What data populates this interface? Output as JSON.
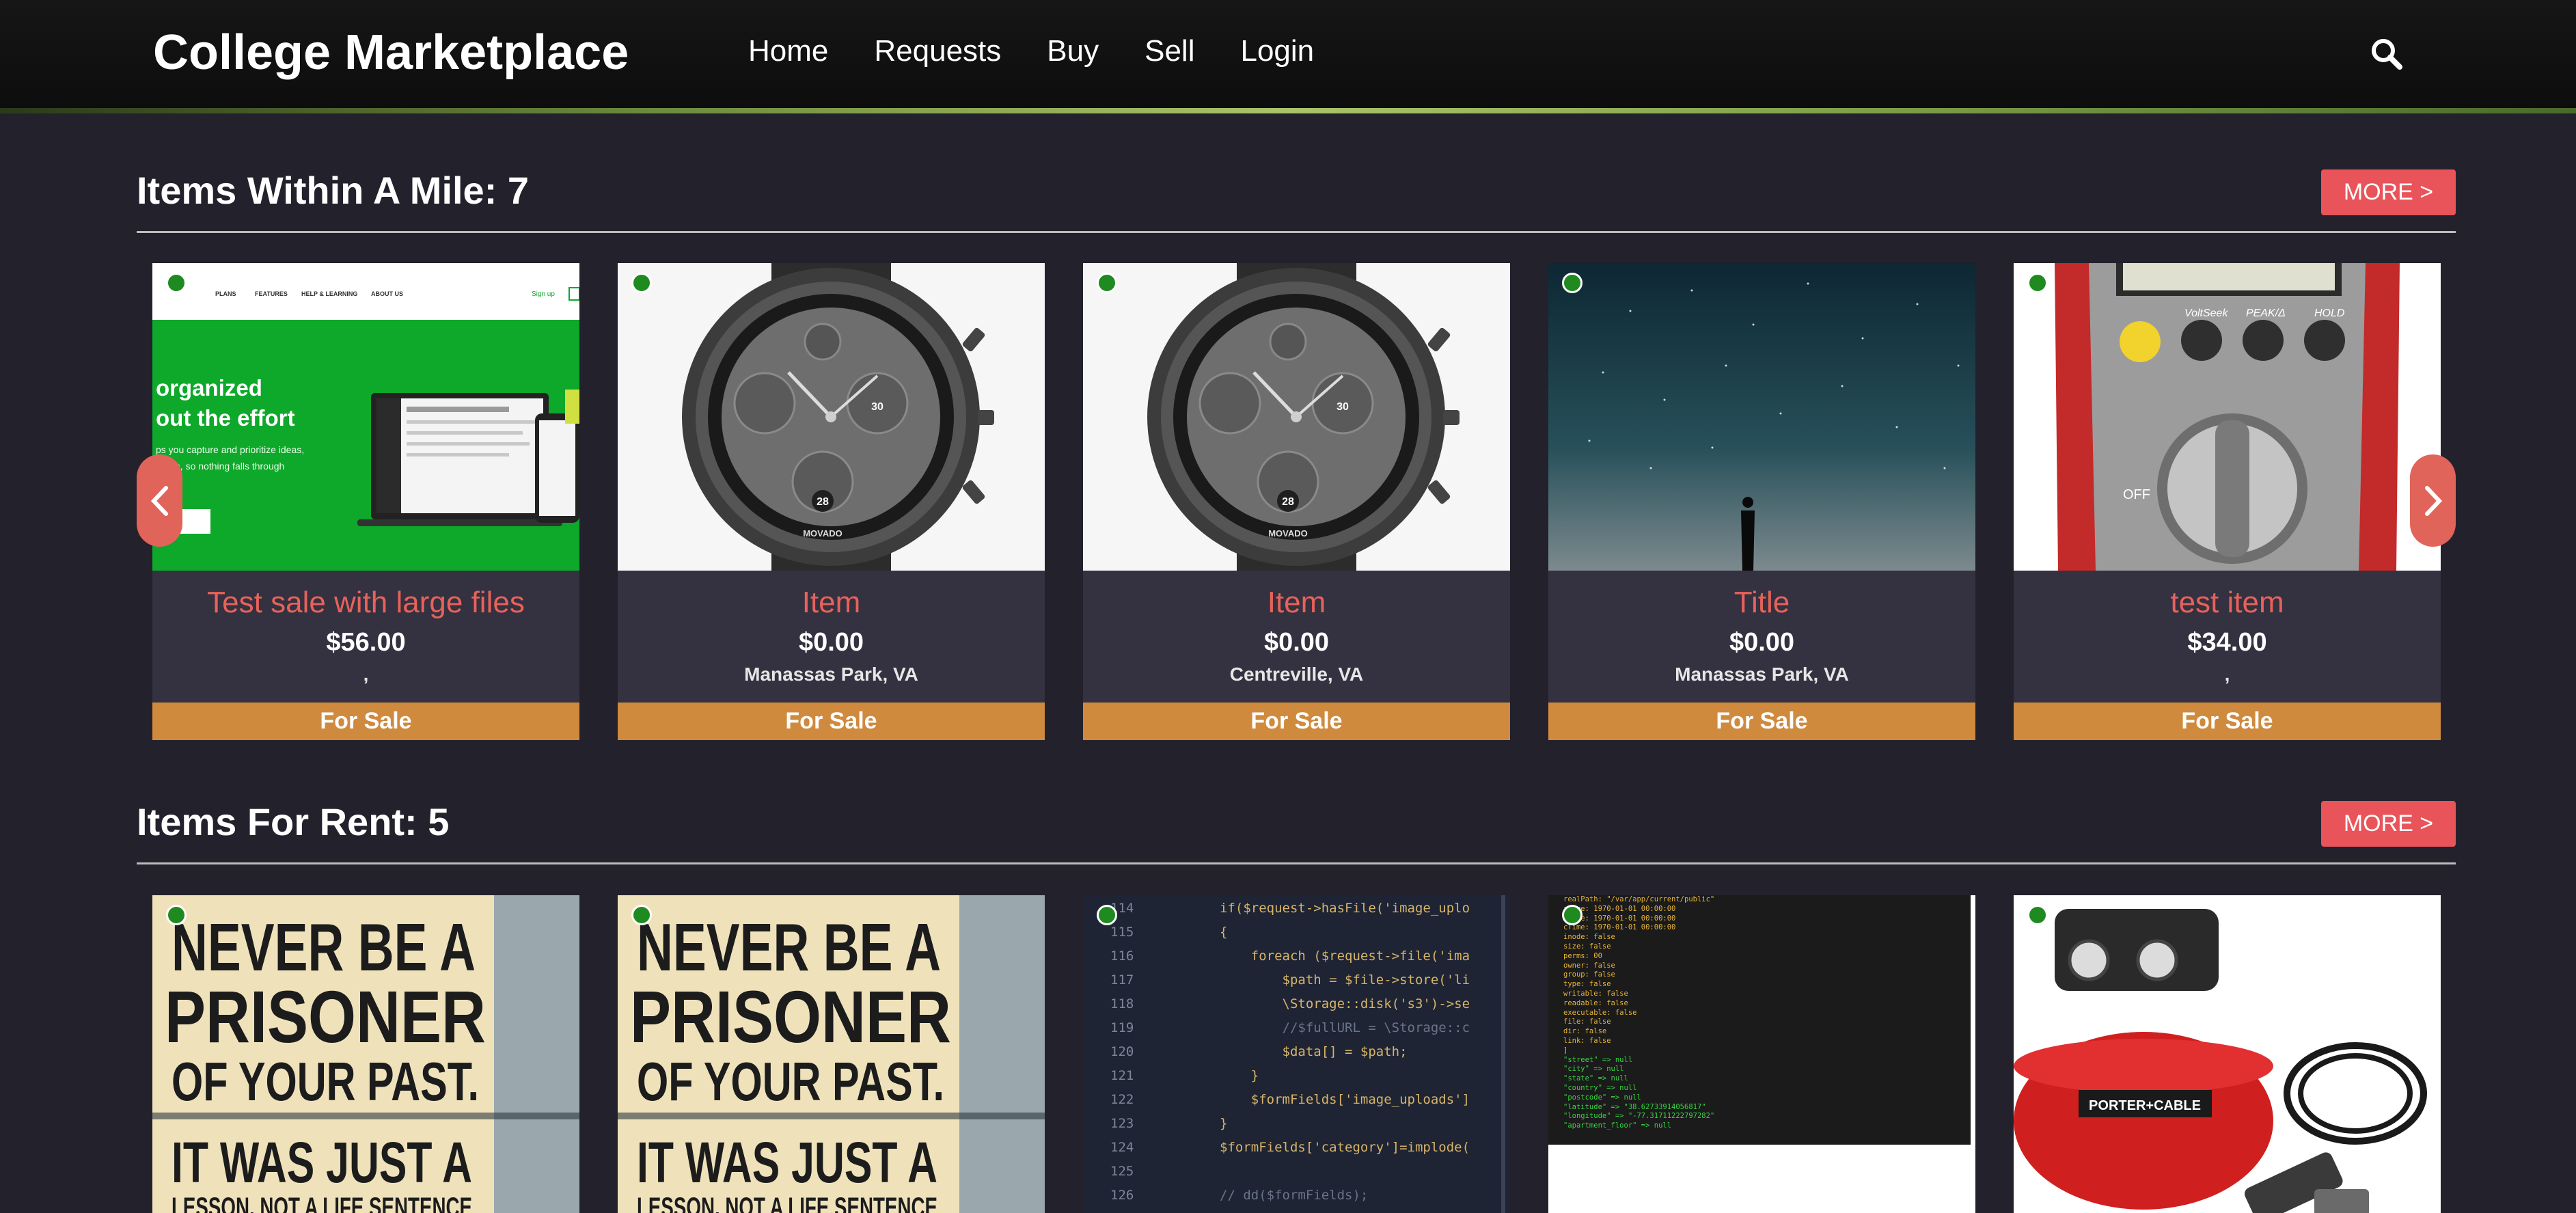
{
  "header": {
    "brand": "College Marketplace",
    "nav": [
      {
        "label": "Home"
      },
      {
        "label": "Requests"
      },
      {
        "label": "Buy"
      },
      {
        "label": "Sell"
      },
      {
        "label": "Login"
      }
    ],
    "search_icon": "search-icon"
  },
  "colors": {
    "accent": "#e8545a",
    "card_title": "#e8625a",
    "status_bar": "#d08a3e",
    "online_dot": "#1f8a1f",
    "background": "#23212c",
    "card_body": "#343140"
  },
  "nearby": {
    "title": "Items Within A Mile: 7",
    "more_label": "MORE >",
    "items": [
      {
        "title": "Test sale with large files",
        "price": "$56.00",
        "location": ",",
        "status": "For Sale",
        "image": "website-screenshot"
      },
      {
        "title": "Item",
        "price": "$0.00",
        "location": "Manassas Park, VA",
        "status": "For Sale",
        "image": "watch"
      },
      {
        "title": "Item",
        "price": "$0.00",
        "location": "Centreville, VA",
        "status": "For Sale",
        "image": "watch"
      },
      {
        "title": "Title",
        "price": "$0.00",
        "location": "Manassas Park, VA",
        "status": "For Sale",
        "image": "night-sky"
      },
      {
        "title": "test item",
        "price": "$34.00",
        "location": ",",
        "status": "For Sale",
        "image": "multimeter"
      }
    ],
    "slide1_text": {
      "menu": [
        "PLANS",
        "FEATURES",
        "HELP & LEARNING",
        "ABOUT US"
      ],
      "signup": "Sign up",
      "headline1": "organized",
      "headline2": "out the effort",
      "sub1": "ps you capture and prioritize ideas,",
      "sub2": "o lists, so nothing falls through"
    },
    "watch_text": {
      "brand": "MOVADO",
      "date": "28",
      "subdial": "30"
    },
    "meter_text": {
      "labels": [
        "VoltSeek",
        "PEAK/Δ",
        "HOLD"
      ],
      "off": "OFF"
    }
  },
  "rent": {
    "title": "Items For Rent: 5",
    "more_label": "MORE >",
    "poster_lines": [
      "NEVER BE A",
      "PRISONER",
      "OF YOUR PAST.",
      "IT WAS JUST A",
      "LESSON, NOT A LIFE SENTENCE"
    ],
    "code_lines": [
      {
        "n": "114",
        "t": "if($request->hasFile('image_uplo"
      },
      {
        "n": "115",
        "t": "{"
      },
      {
        "n": "116",
        "t": "    foreach ($request->file('ima"
      },
      {
        "n": "117",
        "t": "        $path = $file->store('li"
      },
      {
        "n": "118",
        "t": "        \\Storage::disk('s3')->se"
      },
      {
        "n": "119",
        "t": "        //$fullURL = \\Storage::c"
      },
      {
        "n": "120",
        "t": "        $data[] = $path;"
      },
      {
        "n": "121",
        "t": "    }"
      },
      {
        "n": "122",
        "t": "    $formFields['image_uploads']"
      },
      {
        "n": "123",
        "t": "}"
      },
      {
        "n": "124",
        "t": "$formFields['category']=implode("
      },
      {
        "n": "125",
        "t": ""
      },
      {
        "n": "126",
        "t": "// dd($formFields);"
      }
    ],
    "dump_lines": [
      "realPath: \"/var/app/current/public\"",
      "aTime: 1970-01-01 00:00:00",
      "mTime: 1970-01-01 00:00:00",
      "cTime: 1970-01-01 00:00:00",
      "inode: false",
      "size: false",
      "perms: 00",
      "owner: false",
      "group: false",
      "type: false",
      "writable: false",
      "readable: false",
      "executable: false",
      "file: false",
      "dir: false",
      "link: false",
      "]",
      "\"street\" => null",
      "\"city\" => null",
      "\"state\" => null",
      "\"country\" => null",
      "\"postcode\" => null",
      "\"latitude\" => \"38.62733914056817\"",
      "\"longitude\" => \"-77.31711222797282\"",
      "\"apartment_floor\" => null"
    ],
    "compressor_label": "PORTER+CABLE"
  }
}
